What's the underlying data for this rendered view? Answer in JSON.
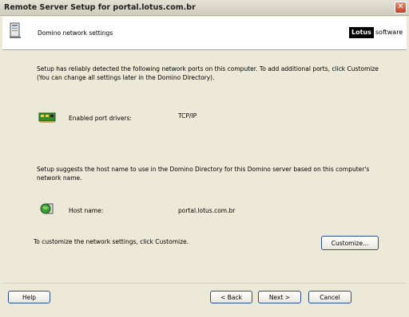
{
  "window": {
    "title": "Remote Server Setup for portal.lotus.com.br"
  },
  "header": {
    "title": "Domino network settings",
    "logo_brand": "Lotus",
    "logo_suffix": "software"
  },
  "content": {
    "intro_line1": "Setup has reliably detected the following network ports on this computer. To add additional ports, click Customize",
    "intro_line2": "(You can change all settings later in the Domino Directory).",
    "port_drivers_label": "Enabled port drivers:",
    "port_drivers_value": "TCP/IP",
    "hostname_intro_line1": "Setup suggests the host name to use in the Domino Directory for this Domino server based on this computer's",
    "hostname_intro_line2": "network name.",
    "host_name_label": "Host name:",
    "host_name_value": "portal.lotus.com.br",
    "customize_text": "To customize the network settings, click Customize."
  },
  "buttons": {
    "customize": "Customize...",
    "help": "Help",
    "back": "< Back",
    "next": "Next >",
    "cancel": "Cancel"
  }
}
